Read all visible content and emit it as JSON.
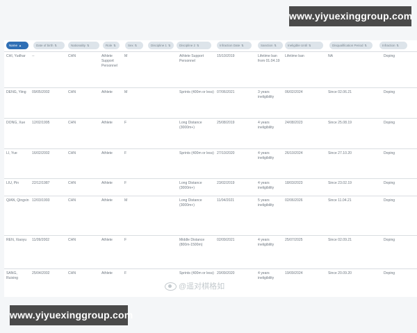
{
  "watermark": {
    "text": "www.yiyuexinggroup.com"
  },
  "overlay_mark": {
    "text": "@遥对棋格如"
  },
  "table": {
    "columns": [
      "Name",
      "Date of birth",
      "Nationality",
      "Role",
      "Sex",
      "Discipline 1",
      "Discipline 2",
      "Infraction Date",
      "Sanction",
      "Ineligible Until",
      "Disqualification Period",
      "Infraction"
    ],
    "sort_indicators": [
      "▲",
      "⇅",
      "⇅",
      "⇅",
      "⇅",
      "⇅",
      "⇅",
      "⇅",
      "⇅",
      "⇅",
      "⇅",
      "⇅"
    ],
    "rows": [
      [
        "CHI, Yudhar",
        "--",
        "CHN",
        "Athlete Support Personnel",
        "M",
        "",
        "Athlete Support Personnel",
        "15/10/2019",
        "Lifetime ban from 01.04.19",
        "Lifetime ban",
        "NA",
        "Doping"
      ],
      [
        "DENG, Yiing",
        "09/05/2002",
        "CHN",
        "Athlete",
        "M",
        "",
        "Sprints (400m or less)",
        "07/06/2021",
        "3 years ineligibility",
        "06/02/2024",
        "Since 02.06.21",
        "Doping"
      ],
      [
        "DONG, Xue",
        "12/02/1995",
        "CHN",
        "Athlete",
        "F",
        "",
        "Long Distance (3000m+)",
        "25/08/2019",
        "4 years ineligibility",
        "24/08/2023",
        "Since 25.08.19",
        "Doping"
      ],
      [
        "LI, Yue",
        "16/02/2002",
        "CHN",
        "Athlete",
        "F",
        "",
        "Sprints (400m or less)",
        "27/10/2020",
        "4 years ineligibility",
        "26/10/2024",
        "Since 27.10.20",
        "Doping"
      ],
      [
        "LIU, Pin",
        "22/12/1987",
        "CHN",
        "Athlete",
        "F",
        "",
        "Long Distance (3000m+)",
        "23/02/2019",
        "4 years ineligibility",
        "18/03/2023",
        "Since 23.02.19",
        "Doping"
      ],
      [
        "QIAN, Qingxin",
        "12/03/1993",
        "CHN",
        "Athlete",
        "M",
        "",
        "Long Distance (3000m+)",
        "11/04/2021",
        "5 years ineligibility",
        "02/06/2026",
        "Since 11.04.21",
        "Doping"
      ],
      [
        "REN, Xiaoyu",
        "11/09/2002",
        "CHN",
        "Athlete",
        "F",
        "",
        "Middle Distance (800m-1500m)",
        "02/09/2021",
        "4 years ineligibility",
        "25/07/2025",
        "Since 02.09.21",
        "Doping"
      ],
      [
        "SANG, Ruixing",
        "25/04/2002",
        "CHN",
        "Athlete",
        "F",
        "",
        "Sprints (400m or less)",
        "20/09/2020",
        "4 years ineligibility",
        "19/09/2024",
        "Since 20.09.20",
        "Doping"
      ]
    ]
  },
  "colors": {
    "active_header": "#2f6fb5",
    "header_bg": "#dde4ea",
    "watermark_bg": "#4a4a4a"
  }
}
